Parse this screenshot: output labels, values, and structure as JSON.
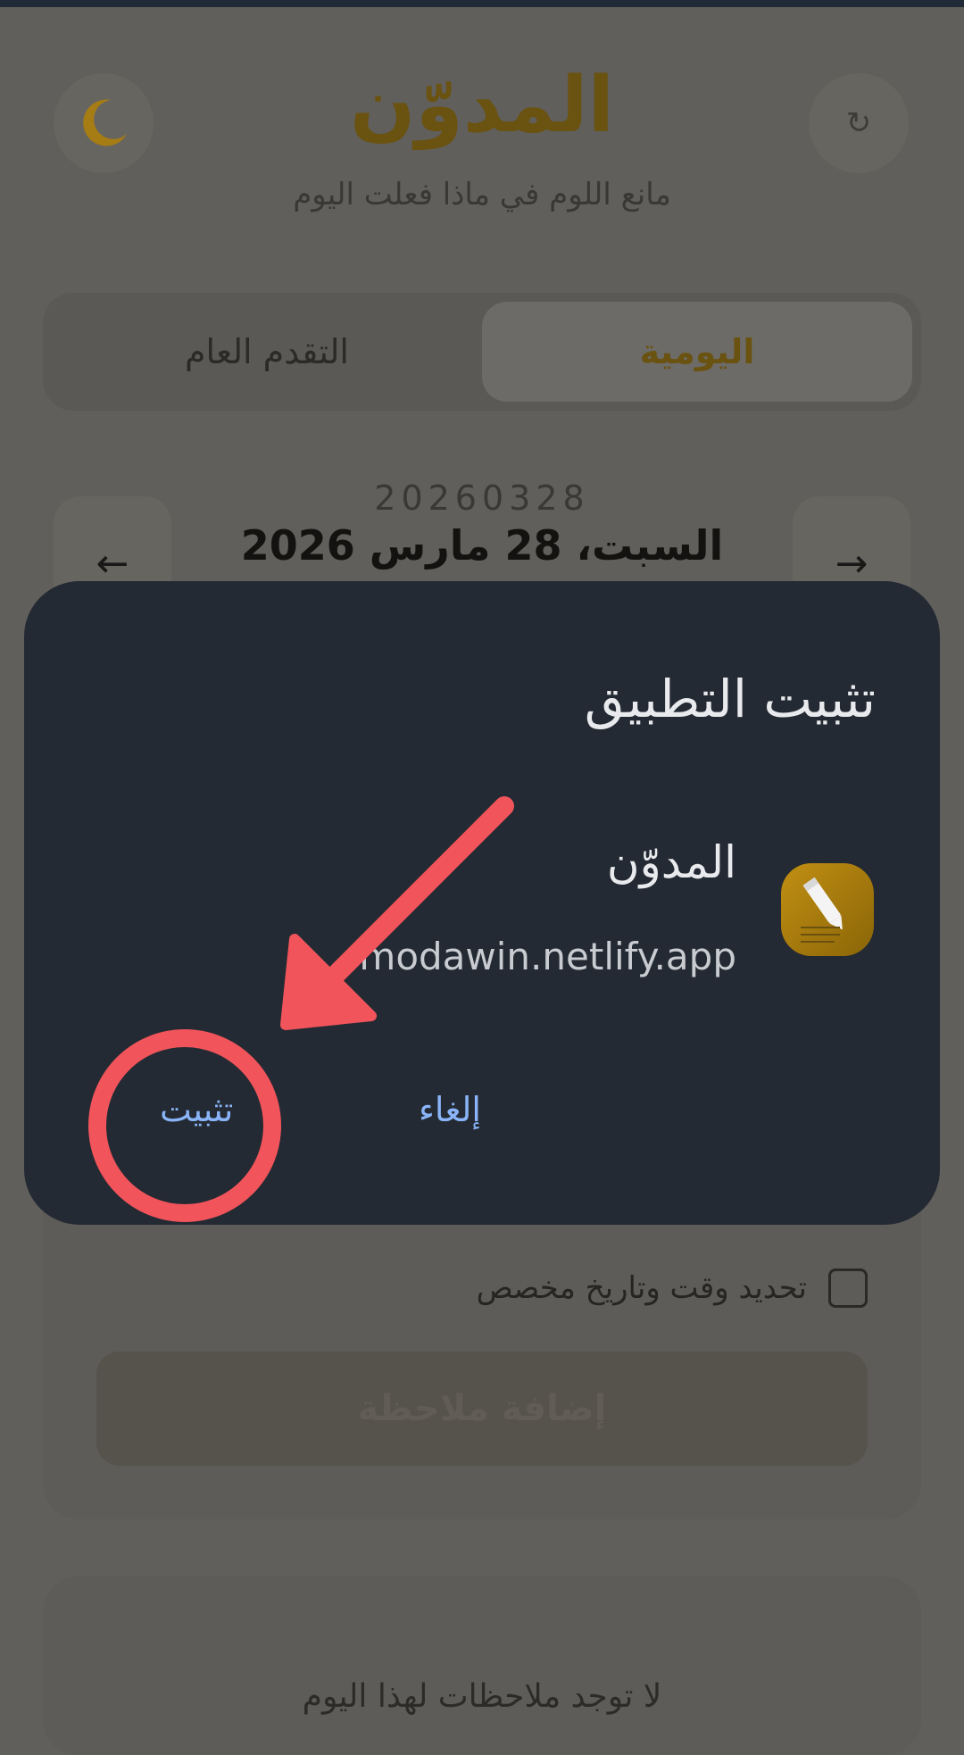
{
  "background_app": {
    "title": "المدوّن",
    "subtitle": "مانع اللوم في ماذا فعلت اليوم",
    "tabs": [
      {
        "label": "اليومية",
        "active": true
      },
      {
        "label": "التقدم العام",
        "active": false
      }
    ],
    "date_code": "20260328",
    "date_label": "السبت، 28 مارس 2026",
    "prev_arrow": "←",
    "next_arrow": "→",
    "refresh_symbol": "↻",
    "custom_datetime_label": "تحديد وقت وتاريخ مخصص",
    "add_note_label": "إضافة ملاحظة",
    "empty_notes_text": "لا توجد ملاحظات لهذا اليوم"
  },
  "install_dialog": {
    "title": "تثبيت التطبيق",
    "app_name": "المدوّن",
    "app_url": "modawin.netlify.app",
    "cancel_label": "إلغاء",
    "install_label": "تثبيت"
  },
  "icons": {
    "theme_toggle": "moon-icon",
    "refresh": "refresh-icon",
    "app_icon": "pencil-notes-icon"
  },
  "colors": {
    "brand_gold": "#b8860b",
    "dialog_bg": "#242a33",
    "dialog_button": "#8ab4f8",
    "annotation_red": "#f2545b"
  }
}
